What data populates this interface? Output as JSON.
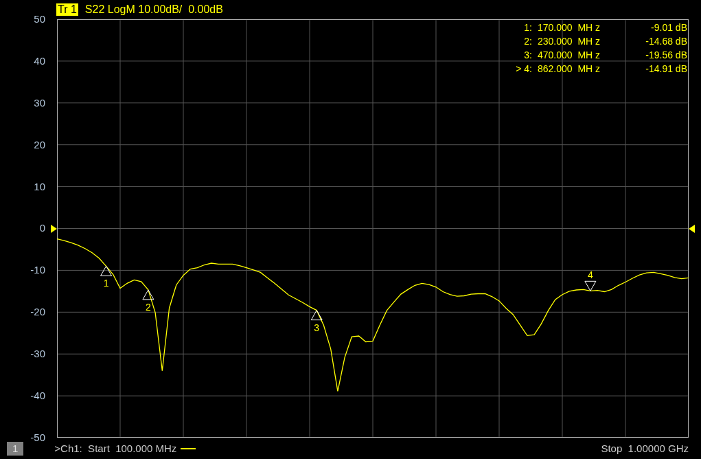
{
  "trace": {
    "badge": "Tr 1",
    "settings": "S22 LogM 10.00dB/  0.00dB"
  },
  "markers": [
    {
      "label": "1:",
      "frequency": "170.000  MH z",
      "value": "-9.01 dB",
      "selected": false
    },
    {
      "label": "2:",
      "frequency": "230.000  MH z",
      "value": "-14.68 dB",
      "selected": false
    },
    {
      "label": "3:",
      "frequency": "470.000  MH z",
      "value": "-19.56 dB",
      "selected": false
    },
    {
      "label": "> 4:",
      "frequency": "862.000  MH z",
      "value": "-14.91 dB",
      "selected": true
    }
  ],
  "chart_data": {
    "type": "line",
    "grid": true,
    "ylim": [
      -50,
      50
    ],
    "yticks": [
      50,
      40,
      30,
      20,
      10,
      0,
      -10,
      -20,
      -30,
      -40,
      -50
    ],
    "categories": [
      null,
      null,
      null,
      null,
      null,
      null,
      null,
      null,
      null,
      null,
      null,
      null,
      null,
      null,
      null,
      null,
      null,
      null,
      null,
      null,
      null,
      null,
      null,
      null,
      null,
      null,
      null,
      null,
      null,
      null,
      null,
      null,
      null,
      null,
      null,
      null,
      null,
      null,
      null,
      null,
      null,
      null,
      null,
      null,
      null,
      null,
      null,
      null,
      null,
      null,
      null,
      null,
      null,
      null,
      null,
      null,
      null,
      null,
      null,
      null,
      null,
      null,
      null,
      null,
      null,
      null,
      null,
      null,
      null,
      null,
      null,
      null,
      null,
      null,
      null,
      null,
      null,
      null,
      null,
      null,
      null,
      null,
      null,
      null,
      null,
      null,
      null,
      null,
      null,
      null,
      null
    ],
    "series": [
      {
        "color": "#ffff00",
        "values": [
          -2.5,
          -2.9,
          -3.4,
          -4.0,
          -4.8,
          -5.8,
          -7.1,
          -9.01,
          -11.0,
          -14.3,
          -13.1,
          -12.3,
          -12.7,
          -14.68,
          -20.1,
          -34.0,
          -19.0,
          -13.5,
          -11.2,
          -9.7,
          -9.4,
          -8.7,
          -8.3,
          -8.5,
          -8.5,
          -8.5,
          -8.9,
          -9.4,
          -9.9,
          -10.5,
          -11.8,
          -13.1,
          -14.5,
          -15.9,
          -16.8,
          -17.7,
          -18.7,
          -19.56,
          -23.1,
          -28.8,
          -38.9,
          -30.8,
          -25.9,
          -25.7,
          -27.1,
          -26.9,
          -23.1,
          -19.6,
          -17.6,
          -15.7,
          -14.6,
          -13.6,
          -13.1,
          -13.4,
          -14.0,
          -15.1,
          -15.8,
          -16.2,
          -16.1,
          -15.7,
          -15.6,
          -15.6,
          -16.3,
          -17.3,
          -19.1,
          -20.6,
          -23.1,
          -25.6,
          -25.4,
          -22.8,
          -19.6,
          -17.0,
          -15.8,
          -15.0,
          -14.7,
          -14.6,
          -14.91,
          -14.8,
          -15.1,
          -14.6,
          -13.6,
          -12.8,
          -11.9,
          -11.1,
          -10.6,
          -10.5,
          -10.8,
          -11.2,
          -11.7,
          -12.0,
          -11.8
        ]
      }
    ],
    "annotations": [
      {
        "y": -9.01,
        "text": "1"
      },
      {
        "y": -14.68,
        "text": "2"
      },
      {
        "y": -19.56,
        "text": "3"
      },
      {
        "y": -14.91,
        "text": "4"
      }
    ]
  },
  "footer": {
    "channel": "1",
    "start": ">Ch1:  Start  100.000 MHz",
    "stop": "Stop  1.00000 GHz"
  }
}
